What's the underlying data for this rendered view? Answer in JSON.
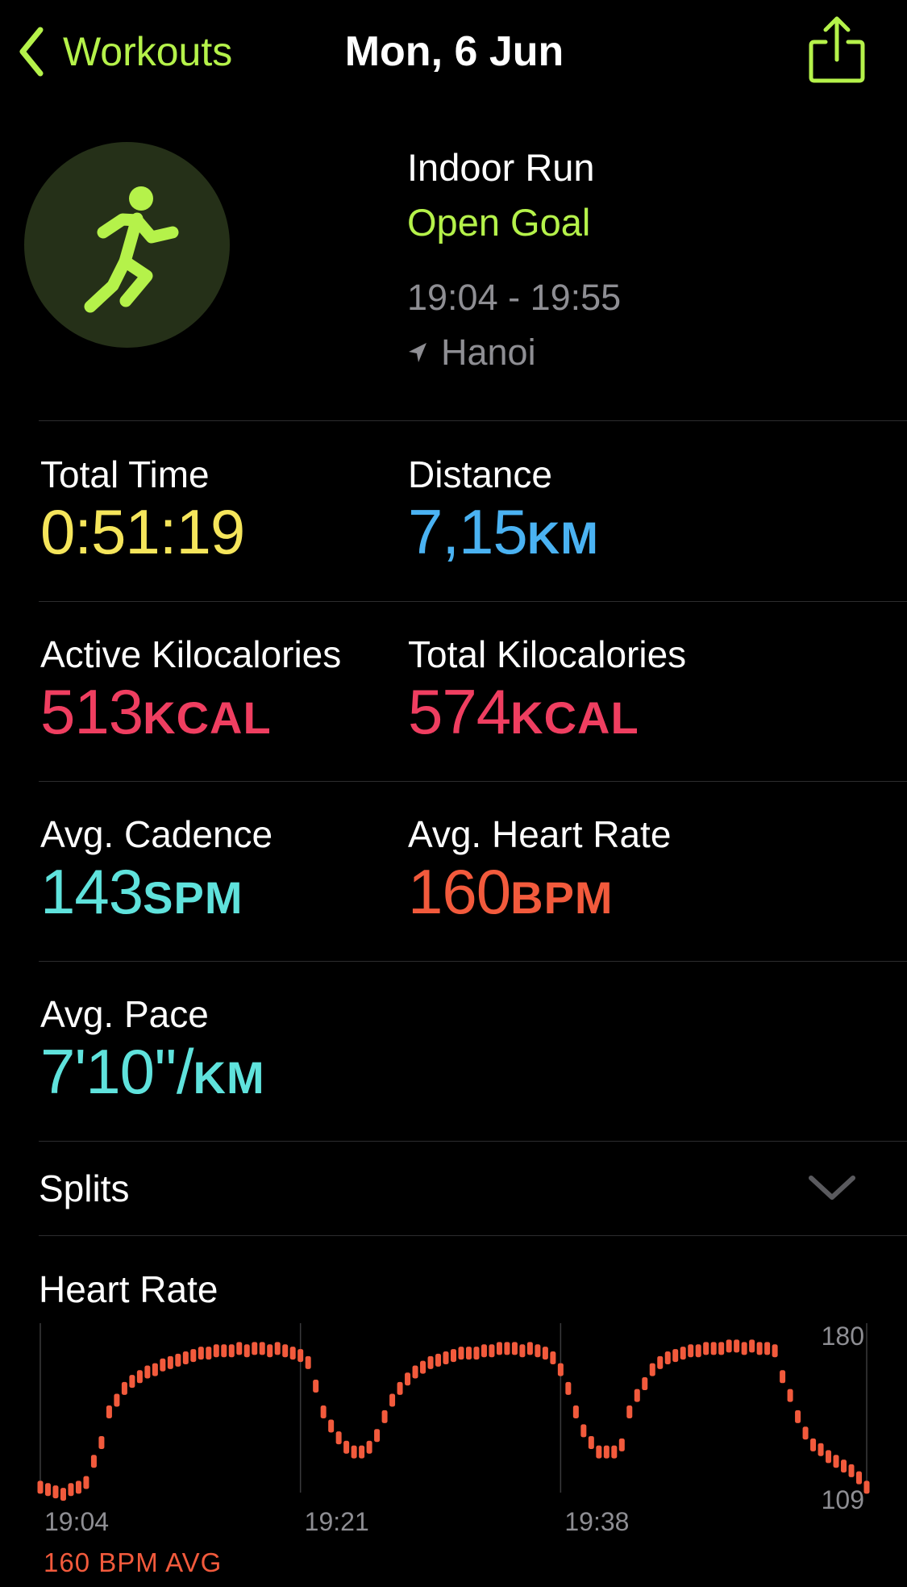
{
  "nav": {
    "back_label": "Workouts",
    "title": "Mon, 6 Jun",
    "back_icon": "chevron-left-icon",
    "share_icon": "share-icon"
  },
  "workout": {
    "icon": "running-figure-icon",
    "type": "Indoor Run",
    "goal": "Open Goal",
    "time_range": "19:04 - 19:55",
    "location": "Hanoi"
  },
  "metrics": {
    "total_time": {
      "label": "Total Time",
      "value": "0:51:19",
      "unit": ""
    },
    "distance": {
      "label": "Distance",
      "value": "7,15",
      "unit": "KM"
    },
    "active_kcal": {
      "label": "Active Kilocalories",
      "value": "513",
      "unit": "KCAL"
    },
    "total_kcal": {
      "label": "Total Kilocalories",
      "value": "574",
      "unit": "KCAL"
    },
    "cadence": {
      "label": "Avg. Cadence",
      "value": "143",
      "unit": "SPM"
    },
    "heart_rate": {
      "label": "Avg. Heart Rate",
      "value": "160",
      "unit": "BPM"
    },
    "pace": {
      "label": "Avg. Pace",
      "value": "7'10''/",
      "unit": "KM"
    }
  },
  "splits": {
    "label": "Splits"
  },
  "heart_rate_chart": {
    "title": "Heart Rate",
    "avg_label": "160 BPM AVG"
  },
  "colors": {
    "accent": "#b5f24a",
    "time": "#f5e55b",
    "distance": "#4ab2f2",
    "calories": "#ef3e60",
    "cadence": "#5fe2dc",
    "heart": "#f25a3c"
  },
  "chart_data": {
    "type": "scatter",
    "title": "Heart Rate",
    "ylim": [
      109,
      180
    ],
    "y_ticks": [
      "180",
      "109"
    ],
    "x_ticks": [
      "19:04",
      "19:21",
      "19:38"
    ],
    "x_domain_minutes": [
      0,
      51
    ],
    "series": [
      {
        "values": [
          [
            0,
            113
          ],
          [
            0.5,
            112
          ],
          [
            1,
            111
          ],
          [
            1.5,
            110
          ],
          [
            2,
            112
          ],
          [
            2.5,
            113
          ],
          [
            3,
            115
          ],
          [
            3.5,
            124
          ],
          [
            4,
            132
          ],
          [
            4.5,
            145
          ],
          [
            5,
            150
          ],
          [
            5.5,
            155
          ],
          [
            6,
            158
          ],
          [
            6.5,
            160
          ],
          [
            7,
            162
          ],
          [
            7.5,
            163
          ],
          [
            8,
            165
          ],
          [
            8.5,
            166
          ],
          [
            9,
            167
          ],
          [
            9.5,
            168
          ],
          [
            10,
            169
          ],
          [
            10.5,
            170
          ],
          [
            11,
            170
          ],
          [
            11.5,
            171
          ],
          [
            12,
            171
          ],
          [
            12.5,
            171
          ],
          [
            13,
            172
          ],
          [
            13.5,
            171
          ],
          [
            14,
            172
          ],
          [
            14.5,
            172
          ],
          [
            15,
            171
          ],
          [
            15.5,
            172
          ],
          [
            16,
            171
          ],
          [
            16.5,
            170
          ],
          [
            17,
            169
          ],
          [
            17.5,
            166
          ],
          [
            18,
            156
          ],
          [
            18.5,
            145
          ],
          [
            19,
            139
          ],
          [
            19.5,
            134
          ],
          [
            20,
            130
          ],
          [
            20.5,
            128
          ],
          [
            21,
            128
          ],
          [
            21.5,
            130
          ],
          [
            22,
            135
          ],
          [
            22.5,
            143
          ],
          [
            23,
            150
          ],
          [
            23.5,
            155
          ],
          [
            24,
            159
          ],
          [
            24.5,
            162
          ],
          [
            25,
            164
          ],
          [
            25.5,
            166
          ],
          [
            26,
            167
          ],
          [
            26.5,
            168
          ],
          [
            27,
            169
          ],
          [
            27.5,
            170
          ],
          [
            28,
            170
          ],
          [
            28.5,
            170
          ],
          [
            29,
            171
          ],
          [
            29.5,
            171
          ],
          [
            30,
            172
          ],
          [
            30.5,
            172
          ],
          [
            31,
            172
          ],
          [
            31.5,
            171
          ],
          [
            32,
            172
          ],
          [
            32.5,
            171
          ],
          [
            33,
            170
          ],
          [
            33.5,
            168
          ],
          [
            34,
            163
          ],
          [
            34.5,
            155
          ],
          [
            35,
            145
          ],
          [
            35.5,
            137
          ],
          [
            36,
            132
          ],
          [
            36.5,
            128
          ],
          [
            37,
            128
          ],
          [
            37.5,
            128
          ],
          [
            38,
            131
          ],
          [
            38.5,
            145
          ],
          [
            39,
            152
          ],
          [
            39.5,
            157
          ],
          [
            40,
            163
          ],
          [
            40.5,
            166
          ],
          [
            41,
            168
          ],
          [
            41.5,
            169
          ],
          [
            42,
            170
          ],
          [
            42.5,
            171
          ],
          [
            43,
            171
          ],
          [
            43.5,
            172
          ],
          [
            44,
            172
          ],
          [
            44.5,
            172
          ],
          [
            45,
            173
          ],
          [
            45.5,
            173
          ],
          [
            46,
            172
          ],
          [
            46.5,
            173
          ],
          [
            47,
            172
          ],
          [
            47.5,
            172
          ],
          [
            48,
            171
          ],
          [
            48.5,
            160
          ],
          [
            49,
            152
          ],
          [
            49.5,
            143
          ],
          [
            50,
            136
          ],
          [
            50.5,
            131
          ],
          [
            51,
            129
          ],
          [
            51.5,
            126
          ],
          [
            52,
            124
          ],
          [
            52.5,
            122
          ],
          [
            53,
            120
          ],
          [
            53.5,
            117
          ],
          [
            54,
            113
          ]
        ]
      }
    ],
    "average": 160
  }
}
